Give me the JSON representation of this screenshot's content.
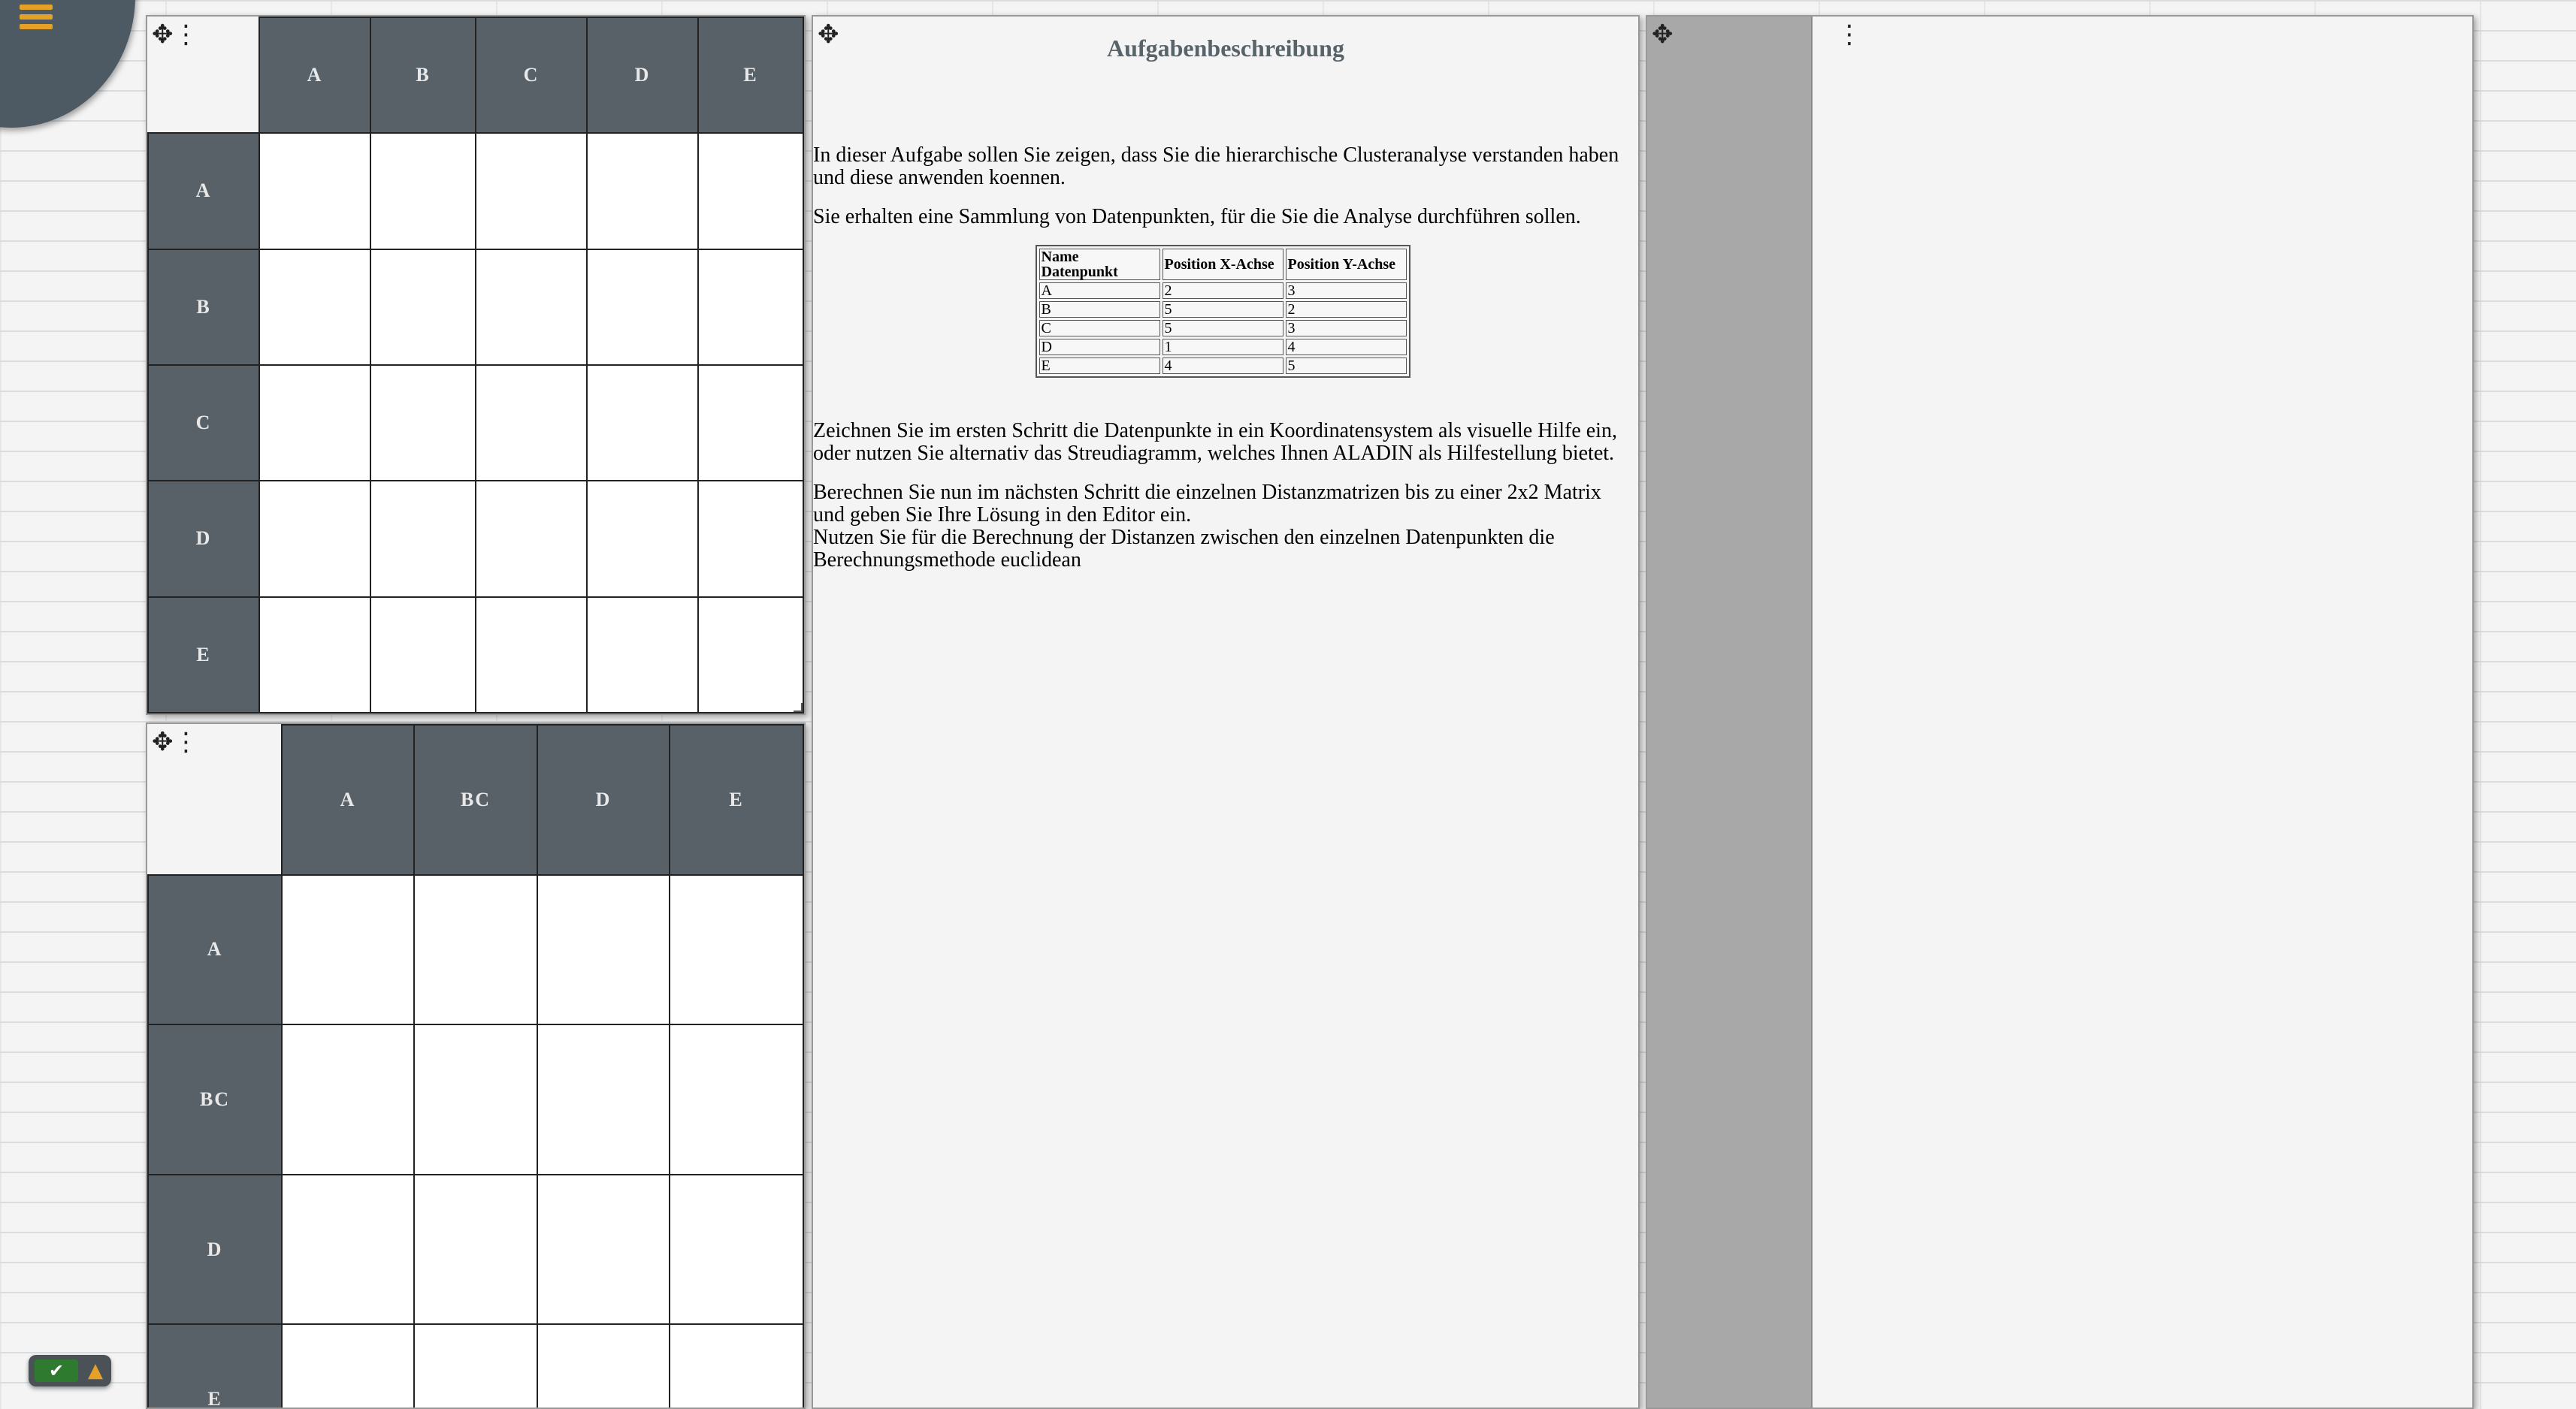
{
  "icons": {
    "menu": "hamburger-icon",
    "move": "move-arrows-icon",
    "more": "vertical-dots-icon",
    "check": "checkmark-icon",
    "warning": "warning-triangle-icon"
  },
  "glyphs": {
    "move": "✥",
    "more": "⋮",
    "check": "✔",
    "warning": "▲"
  },
  "colors": {
    "header": "#586168",
    "accent": "#e5a028",
    "ok": "#2e7a2e",
    "title": "#58636a"
  },
  "matrix1": {
    "columns": [
      "A",
      "B",
      "C",
      "D",
      "E"
    ],
    "rows": [
      "A",
      "B",
      "C",
      "D",
      "E"
    ]
  },
  "matrix2": {
    "columns": [
      "A",
      "BC",
      "D",
      "E"
    ],
    "rows": [
      "A",
      "BC",
      "D",
      "E"
    ]
  },
  "task": {
    "title": "Aufgabenbeschreibung",
    "para1": "In dieser Aufgabe sollen Sie zeigen, dass Sie die hierarchische Clusteranalyse verstanden haben und diese anwenden koennen.",
    "para2": "Sie erhalten eine Sammlung von Datenpunkten, für die Sie die Analyse durchführen sollen.",
    "table": {
      "headers": [
        "Name Datenpunkt",
        "Position X-Achse",
        "Position Y-Achse"
      ],
      "rows": [
        [
          "A",
          "2",
          "3"
        ],
        [
          "B",
          "5",
          "2"
        ],
        [
          "C",
          "5",
          "3"
        ],
        [
          "D",
          "1",
          "4"
        ],
        [
          "E",
          "4",
          "5"
        ]
      ]
    },
    "para3": "Zeichnen Sie im ersten Schritt die Datenpunkte in ein Koordinatensystem als visuelle Hilfe ein, oder nutzen Sie alternativ das Streudiagramm, welches Ihnen ALADIN als Hilfestellung bietet.",
    "para4": "Berechnen Sie nun im nächsten Schritt die einzelnen Distanzmatrizen bis zu einer 2x2 Matrix und geben Sie Ihre Lösung in den Editor ein.",
    "para5": "Nutzen Sie für die Berechnung der Distanzen zwischen den einzelnen Datenpunkten die Berechnungsmethode euclidean"
  }
}
